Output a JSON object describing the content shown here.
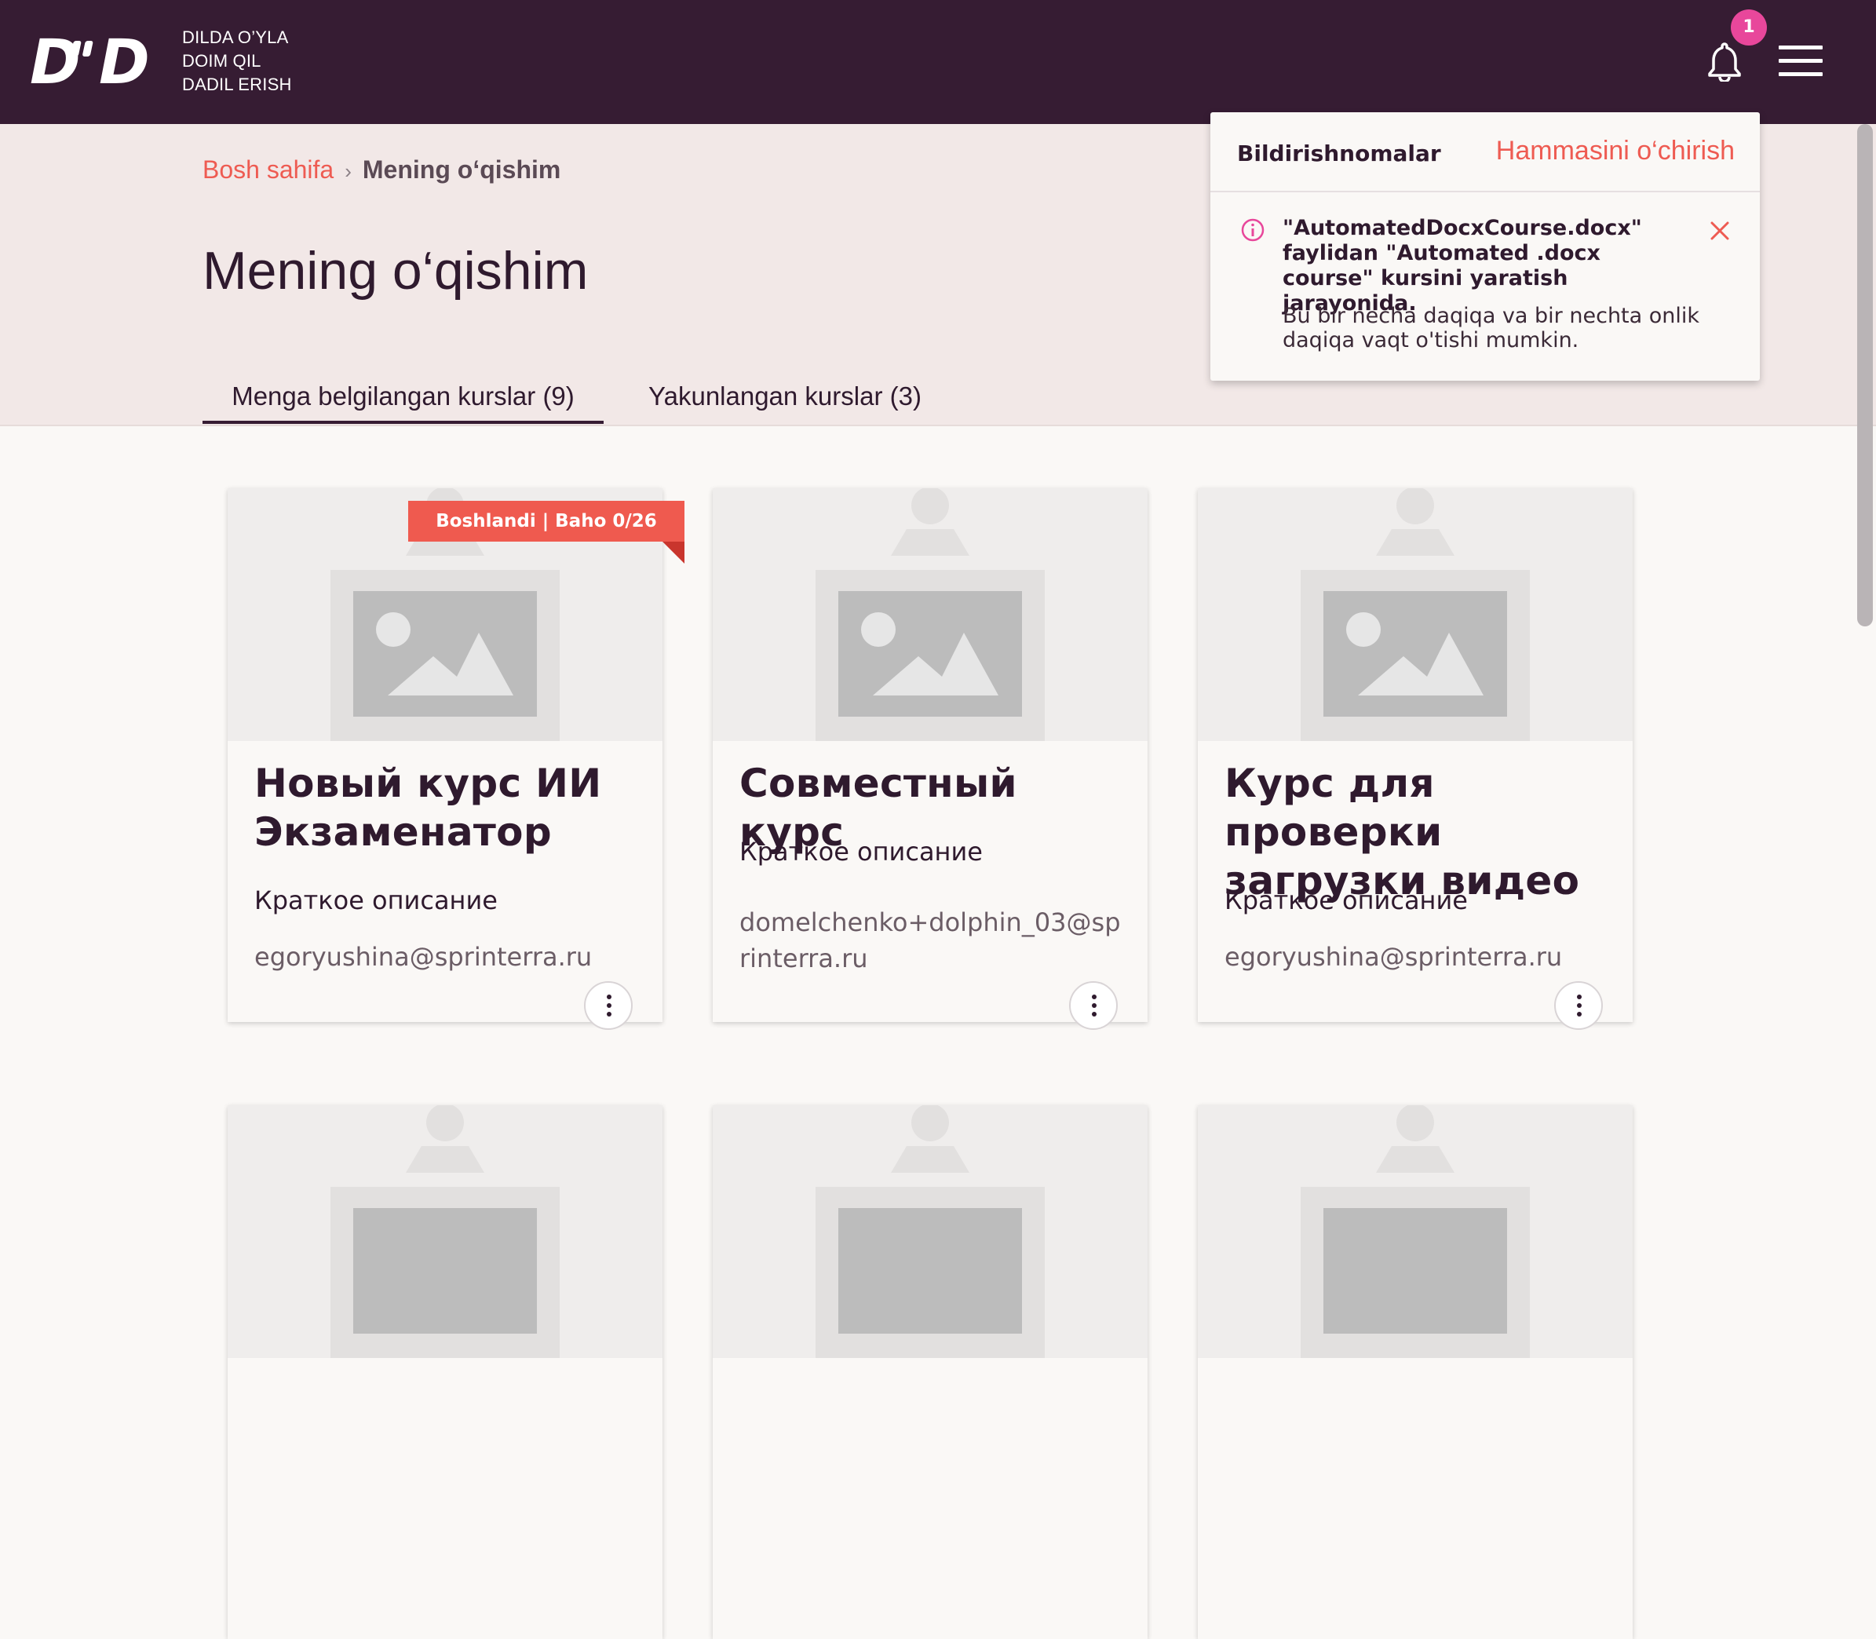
{
  "header": {
    "logo": "D'D",
    "tagline": [
      "DILDA O’YLA",
      "DOIM QIL",
      "DADIL ERISH"
    ],
    "notification_count": "1",
    "icons": {
      "bell": "bell-icon",
      "menu": "hamburger-menu-icon"
    }
  },
  "breadcrumb": {
    "home": "Bosh sahifa",
    "separator": "›",
    "current": "Mening o‘qishim"
  },
  "page_title": "Mening o‘qishim",
  "tabs": [
    {
      "label": "Menga belgilangan kurslar (9)",
      "active": true
    },
    {
      "label": "Yakunlangan kurslar (3)",
      "active": false
    }
  ],
  "courses": [
    {
      "status": "Boshlandi | Baho 0/26",
      "title": "Новый курс ИИ Экзаменатор",
      "description": "Краткое описание",
      "author": "egoryushina@sprinterra.ru"
    },
    {
      "status": "",
      "title": "Совместный курс",
      "description": "Краткое описание",
      "author": "domelchenko+dolphin_03@sprinterra.ru"
    },
    {
      "status": "",
      "title": "Курс для проверки загрузки видео",
      "description": "Краткое описание",
      "author": "egoryushina@sprinterra.ru"
    }
  ],
  "notifications_panel": {
    "title": "Bildirishnomalar",
    "clear_all": "Hammasini o‘chirish",
    "items": [
      {
        "message": "\"AutomatedDocxCourse.docx\" faylidan \"Automated .docx course\" kursini yaratish jarayonida.",
        "detail": "Bu bir necha daqiqa va bir nechta onlik daqiqa vaqt o'tishi mumkin.",
        "icon": "info-icon"
      }
    ]
  },
  "colors": {
    "header_bg": "#361c33",
    "hero_bg": "#f2e8e7",
    "accent": "#ee5b52",
    "badge": "#e8479b"
  }
}
